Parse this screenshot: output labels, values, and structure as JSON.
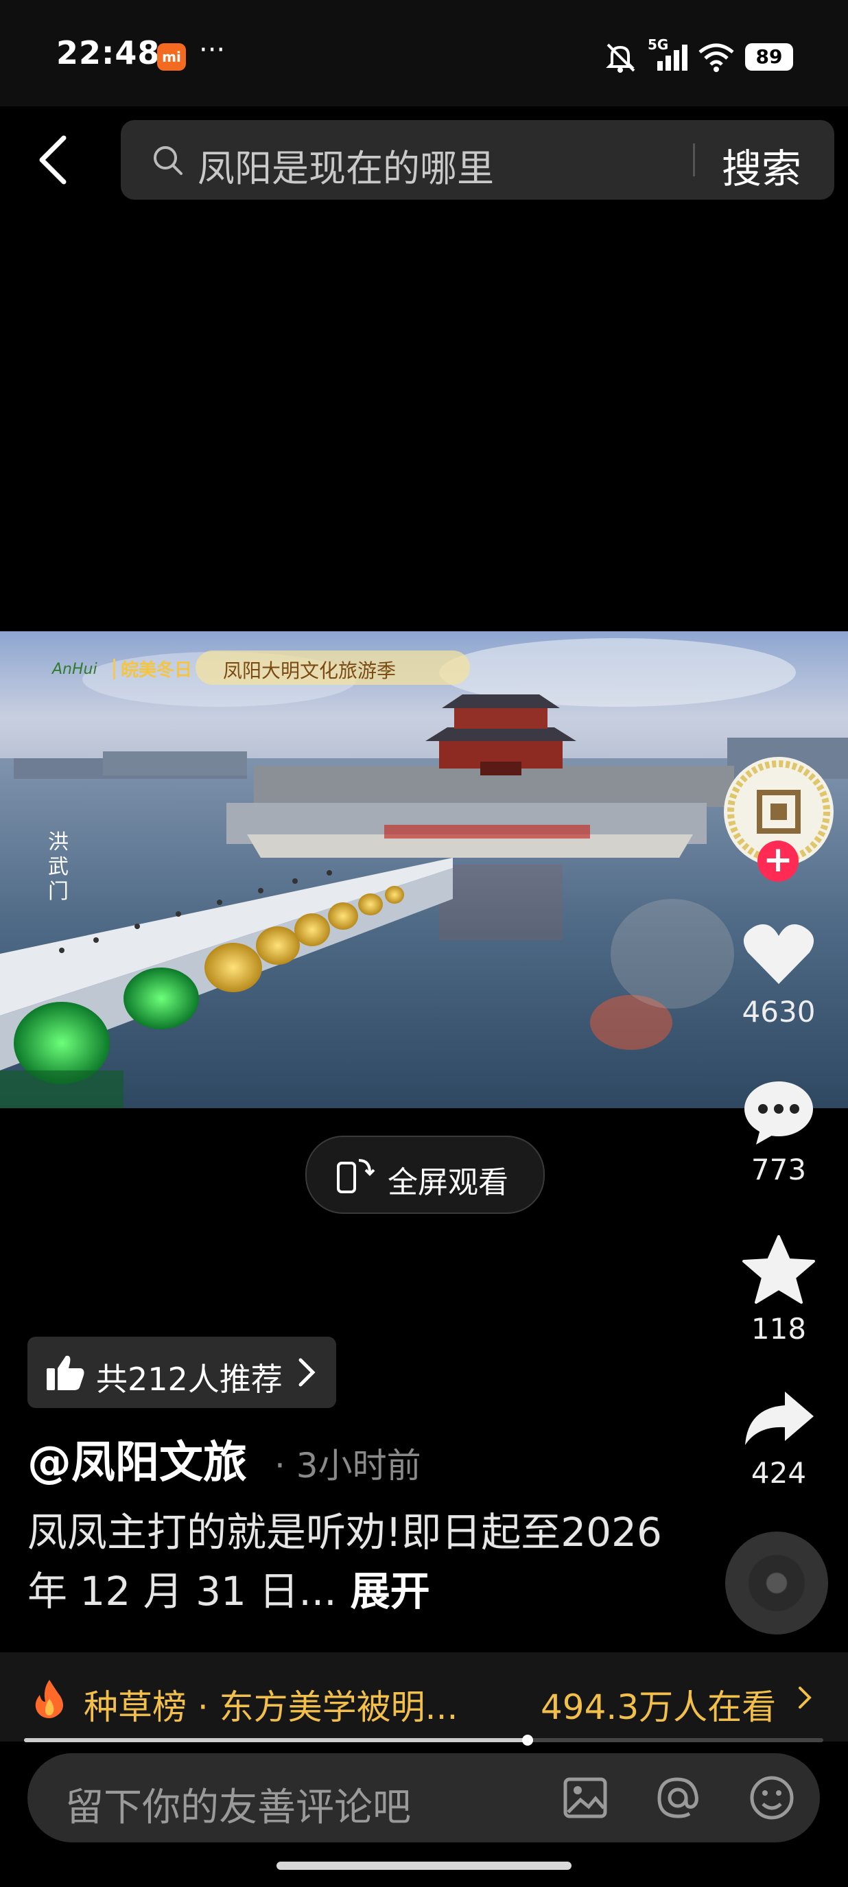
{
  "status_bar": {
    "time": "22:48",
    "carrier_badge": "mi",
    "more": "···",
    "network": "5G",
    "battery": "89"
  },
  "search": {
    "query": "凤阳是现在的哪里",
    "button": "搜索"
  },
  "video": {
    "watermark_tag": "皖美冬日",
    "banner": "凤阳大明文化旅游季",
    "place_label": "洪武门"
  },
  "fullscreen": {
    "label": "全屏观看"
  },
  "actions": {
    "likes": "4630",
    "comments": "773",
    "favorites": "118",
    "shares": "424"
  },
  "recommend": {
    "label": "共212人推荐"
  },
  "post": {
    "author": "@凤阳文旅",
    "time": "· 3小时前",
    "caption": "凤凤主打的就是听劝!即日起至2026 年 12 月 31 日...",
    "expand": "展开"
  },
  "trending": {
    "title": "种草榜 · 东方美学被明...",
    "viewers": "494.3万人在看"
  },
  "playback": {
    "progress": 0.63
  },
  "comment": {
    "placeholder": "留下你的友善评论吧"
  }
}
